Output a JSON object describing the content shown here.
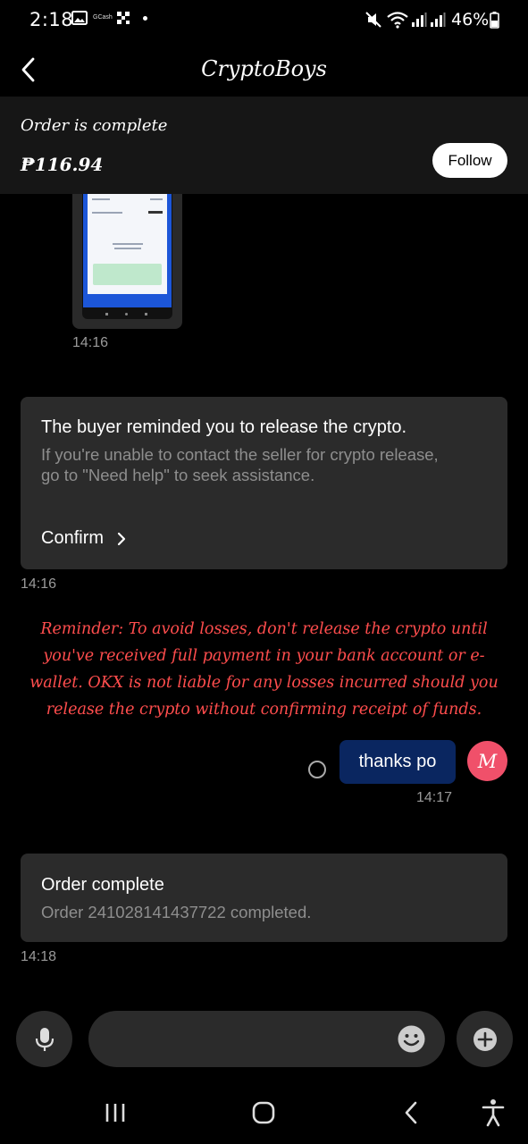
{
  "status_bar": {
    "time": "2:18",
    "gcash_label": "GCash",
    "battery": "46%",
    "icons": [
      "gallery-icon",
      "qr-icon",
      "dot-icon",
      "mute-icon",
      "wifi-icon",
      "signal-icon",
      "battery-icon"
    ]
  },
  "header": {
    "title": "CryptoBoys",
    "back_icon": "back-arrow-icon"
  },
  "order_banner": {
    "status": "Order is complete",
    "amount": "₱116.94",
    "follow_label": "Follow"
  },
  "messages": [
    {
      "type": "image",
      "time": "14:16"
    },
    {
      "type": "system_card",
      "title": "The buyer reminded you to release the crypto.",
      "description": "If you're unable to contact the seller for crypto release, go to \"Need help\" to seek assistance.",
      "action_label": "Confirm",
      "time": "14:16"
    },
    {
      "type": "warning",
      "text": "Reminder: To avoid losses, don't release the crypto until you've received full payment in your bank account or e-wallet. OKX is not liable for any losses incurred should you release the crypto without confirming receipt of funds."
    },
    {
      "type": "outgoing",
      "text": "thanks po",
      "avatar_letter": "M",
      "time": "14:17"
    },
    {
      "type": "system_card",
      "title": "Order complete",
      "description": "Order 241028141437722 completed.",
      "time": "14:18"
    }
  ],
  "composer": {
    "placeholder": "",
    "mic_icon": "microphone-icon",
    "emoji_icon": "emoji-icon",
    "plus_icon": "plus-icon"
  },
  "colors": {
    "background": "#000000",
    "card": "#2b2b2b",
    "banner": "#161616",
    "warning": "#ff4d4d",
    "bubble": "#0a2660",
    "avatar": "#f0506a"
  }
}
